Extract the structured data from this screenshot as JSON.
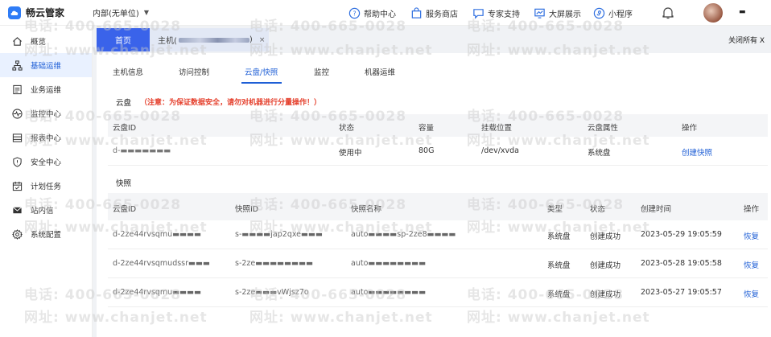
{
  "header": {
    "app_name": "畅云管家",
    "org_label": "内部(无单位)",
    "nav": [
      {
        "label": "帮助中心",
        "icon": "question-circle-icon"
      },
      {
        "label": "服务商店",
        "icon": "shopping-bag-icon"
      },
      {
        "label": "专家支持",
        "icon": "expert-chat-icon"
      },
      {
        "label": "大屏展示",
        "icon": "chart-screen-icon"
      },
      {
        "label": "小程序",
        "icon": "mini-program-icon"
      }
    ],
    "user_name": "▬"
  },
  "sidebar": {
    "items": [
      {
        "label": "概览",
        "icon": "home-icon",
        "active": false
      },
      {
        "label": "基础运维",
        "icon": "org-chart-icon",
        "active": true
      },
      {
        "label": "业务运维",
        "icon": "document-icon",
        "active": false
      },
      {
        "label": "监控中心",
        "icon": "pulse-icon",
        "active": false
      },
      {
        "label": "报表中心",
        "icon": "report-icon",
        "active": false
      },
      {
        "label": "安全中心",
        "icon": "shield-icon",
        "active": false
      },
      {
        "label": "计划任务",
        "icon": "calendar-icon",
        "active": false
      },
      {
        "label": "站内信",
        "icon": "mail-icon",
        "active": false
      },
      {
        "label": "系统配置",
        "icon": "gear-icon",
        "active": false
      }
    ]
  },
  "tabs": {
    "home": "首页",
    "host_prefix": "主机(",
    "host_suffix": ")",
    "close": "×",
    "close_all": "关闭所有 X"
  },
  "subtabs": [
    {
      "label": "主机信息"
    },
    {
      "label": "访问控制"
    },
    {
      "label": "云盘/快照",
      "active": true
    },
    {
      "label": "监控"
    },
    {
      "label": "机器运维"
    }
  ],
  "disk_section": {
    "title": "云盘",
    "warning": "（注意：为保证数据安全，请勿对机器进行分量操作！）",
    "columns": [
      "云盘ID",
      "状态",
      "容量",
      "挂载位置",
      "云盘属性",
      "操作"
    ],
    "rows": [
      {
        "id": "d-▬▬▬▬▬▬▬",
        "status": "使用中",
        "capacity": "80G",
        "mount": "/dev/xvda",
        "attr": "系统盘",
        "action": "创建快照"
      }
    ]
  },
  "snapshot_section": {
    "title": "快照",
    "columns": [
      "云盘ID",
      "快照ID",
      "快照名称",
      "类型",
      "状态",
      "创建时间",
      "操作"
    ],
    "rows": [
      {
        "disk_id": "d-2ze44rvsqmu▬▬▬▬",
        "snap_id": "s-▬▬▬▬jap2qxe▬▬▬",
        "name": "auto▬▬▬▬sp-2ze8▬▬▬▬",
        "type": "系统盘",
        "status": "创建成功",
        "time": "2023-05-29 19:05:59",
        "action": "恢复"
      },
      {
        "disk_id": "d-2ze44rvsqmudssr▬▬▬",
        "snap_id": "s-2ze▬▬▬▬▬▬▬▬",
        "name": "auto▬▬▬▬▬▬▬▬",
        "type": "系统盘",
        "status": "创建成功",
        "time": "2023-05-28 19:05:58",
        "action": "恢复"
      },
      {
        "disk_id": "d-2ze44rvsqmu▬▬▬▬",
        "snap_id": "s-2ze▬▬▬vWjsz7o",
        "name": "auto▬▬▬▬▬▬▬▬",
        "type": "系统盘",
        "status": "创建成功",
        "time": "2023-05-27 19:05:57",
        "action": "恢复"
      }
    ]
  },
  "watermark": {
    "phone": "电话: 400-665-0028",
    "site": "网址: www.chanjet.net"
  },
  "colors": {
    "accent": "#1f5fd6",
    "active_tab": "#3a63ea",
    "warning": "#e5412e"
  }
}
